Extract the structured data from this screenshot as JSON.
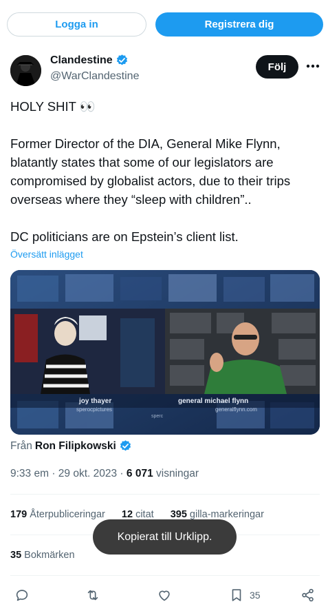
{
  "topbar": {
    "login_label": "Logga in",
    "register_label": "Registrera dig"
  },
  "author": {
    "display_name": "Clandestine",
    "handle": "@WarClandestine",
    "follow_label": "Följ",
    "verified_icon": "verified-badge-icon",
    "more_icon": "more-horizontal-icon"
  },
  "tweet": {
    "line1": "HOLY SHIT 👀",
    "para2": "Former Director of the DIA, General Mike Flynn, blatantly states that some of our legislators are compromised by globalist actors, due to their trips overseas where they “sleep with children”..",
    "para3": "DC politicians are on Epstein’s client list.",
    "translate": "Översätt inlägget"
  },
  "media": {
    "left_caption": "joy thayer",
    "left_sub": "sperocpictures",
    "right_caption": "general michael flynn",
    "right_sub": "generalflynn.com",
    "center_mark": "sperc"
  },
  "source": {
    "prefix": "Från",
    "name": "Ron Filipkowski"
  },
  "meta": {
    "time": "9:33 em",
    "sep1": " · ",
    "date": "29 okt. 2023",
    "sep2": " · ",
    "views": "6 071",
    "views_label": "visningar"
  },
  "stats": {
    "reposts": "179",
    "reposts_label": "Återpubliceringar",
    "quotes": "12",
    "quotes_label": "citat",
    "likes": "395",
    "likes_label": "gilla-markeringar"
  },
  "bookmarks": {
    "count": "35",
    "label": "Bokmärken"
  },
  "toast": "Kopierat till Urklipp.",
  "actions": {
    "bookmark_count": "35"
  },
  "colors": {
    "accent": "#1d9bf0",
    "text": "#0f1419",
    "muted": "#536471",
    "divider": "#eff3f4",
    "toast": "#3b3b3b"
  }
}
